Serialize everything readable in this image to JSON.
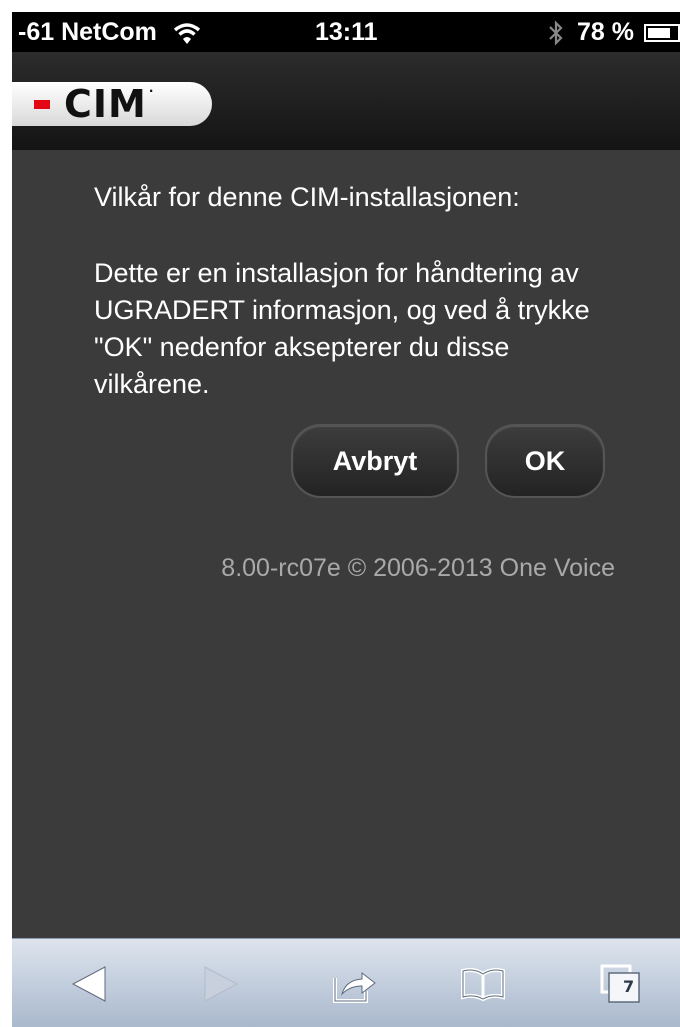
{
  "status_bar": {
    "carrier": "-61 NetCom",
    "time": "13:11",
    "battery": "78 %",
    "battery_level": 0.78
  },
  "header": {
    "logo_text": "CIM",
    "logo_mark": "·",
    "brand_color": "#e30613"
  },
  "content": {
    "heading": "Vilkår for denne CIM-installasjonen:",
    "body": "Dette er en installasjon for håndtering av UGRADERT informasjon, og ved å trykke \"OK\" nedenfor aksepterer du disse vilkårene.",
    "cancel_label": "Avbryt",
    "ok_label": "OK",
    "version": "8.00-rc07e © 2006-2013 One Voice"
  },
  "toolbar": {
    "icons": [
      "back-icon",
      "forward-icon",
      "share-icon",
      "bookmarks-icon",
      "tabs-icon"
    ],
    "tab_count": "7"
  }
}
